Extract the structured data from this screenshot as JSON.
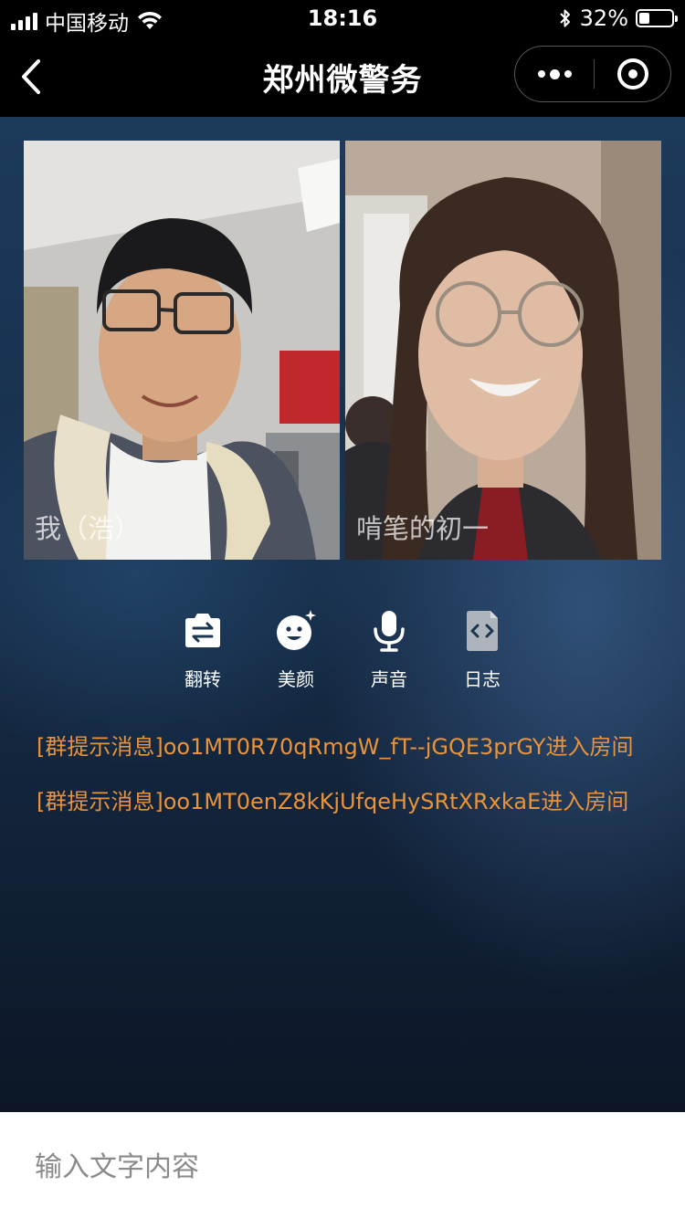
{
  "status_bar": {
    "carrier": "中国移动",
    "time": "18:16",
    "battery_text": "32%",
    "battery_level": 0.32
  },
  "nav": {
    "title": "郑州微警务"
  },
  "video": {
    "local_label": "我（浩）",
    "remote_label": "啃笔的初一"
  },
  "controls": [
    {
      "label": "翻转",
      "icon": "camera-switch-icon"
    },
    {
      "label": "美颜",
      "icon": "beauty-face-icon"
    },
    {
      "label": "声音",
      "icon": "microphone-icon"
    },
    {
      "label": "日志",
      "icon": "log-code-icon"
    }
  ],
  "messages": [
    "[群提示消息]oo1MT0R70qRmgW_fT--jGQE3prGY进入房间",
    "[群提示消息]oo1MT0enZ8kKjUfqeHySRtXRxkaE进入房间"
  ],
  "input": {
    "placeholder": "输入文字内容",
    "value": ""
  },
  "colors": {
    "message_text": "#e9933a",
    "nav_background": "#000000",
    "main_background": "#17304c"
  }
}
